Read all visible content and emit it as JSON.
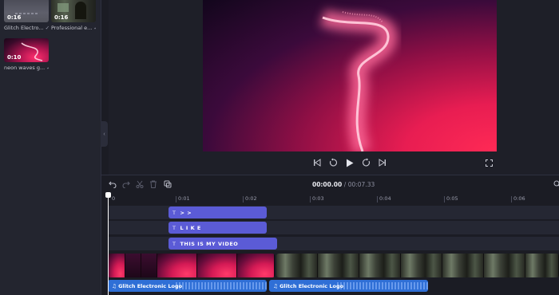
{
  "media": {
    "items": [
      {
        "duration": "0:16",
        "name": "Glitch Electro...",
        "check": "✓"
      },
      {
        "duration": "0:16",
        "name": "Professional e...",
        "check": "✓"
      },
      {
        "duration": "0:10",
        "name": "neon waves g...",
        "check": "✓"
      }
    ]
  },
  "sidebar": {
    "collapse_icon": "‹"
  },
  "player": {
    "icons": [
      "skip-back-icon",
      "rewind-5-icon",
      "play-icon",
      "forward-5-icon",
      "skip-forward-icon",
      "fullscreen-icon"
    ]
  },
  "timeline": {
    "current_time": "00:00.00",
    "total_time": "/ 00:07.33",
    "ruler": [
      "0",
      "0:01",
      "0:02",
      "0:03",
      "0:04",
      "0:05",
      "0:06"
    ],
    "text_clips": [
      {
        "label": "> >"
      },
      {
        "label": "L I K E"
      },
      {
        "label": "THIS IS MY VIDEO"
      }
    ],
    "audio_clips": [
      {
        "label": "Glitch Electronic Logo"
      },
      {
        "label": "Glitch Electronic Logo"
      }
    ],
    "toolbar_icons": [
      "undo-icon",
      "redo-icon",
      "cut-icon",
      "delete-icon",
      "copy-icon"
    ]
  },
  "colors": {
    "text_clip": "#5b5bd6",
    "audio_clip": "#2f6fd6",
    "background": "#1b1c24"
  }
}
